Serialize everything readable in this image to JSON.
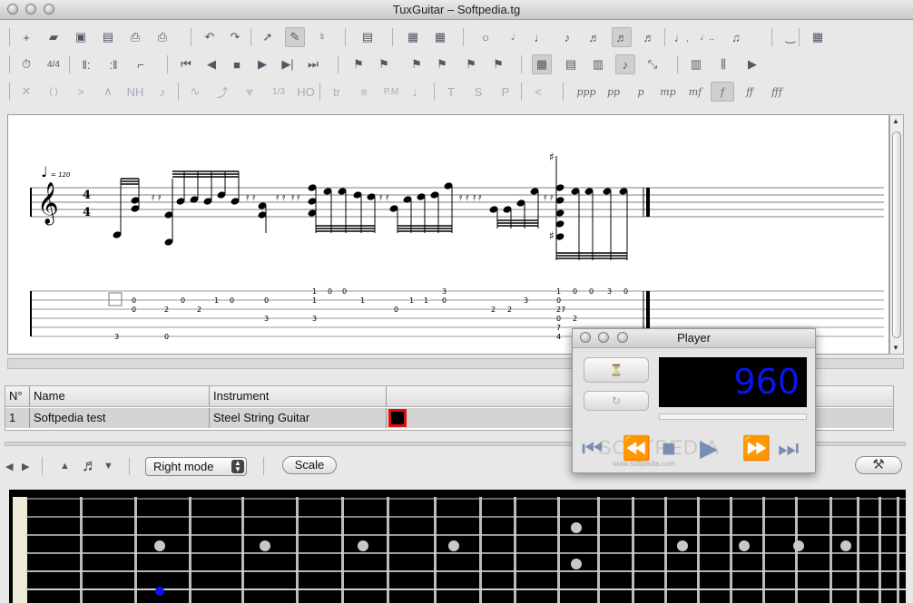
{
  "window": {
    "title": "TuxGuitar – Softpedia.tg"
  },
  "toolbar_row1": [
    {
      "icon": "new-document-icon",
      "glyph": "+"
    },
    {
      "icon": "open-folder-icon",
      "glyph": "▰"
    },
    {
      "icon": "save-icon",
      "glyph": "▣"
    },
    {
      "icon": "save-as-icon",
      "glyph": "▤"
    },
    {
      "icon": "print-icon",
      "glyph": "⎙"
    },
    {
      "icon": "print-preview-icon",
      "glyph": "⎙"
    },
    {
      "icon": "undo-icon",
      "glyph": "↶"
    },
    {
      "icon": "redo-icon",
      "glyph": "↷"
    },
    {
      "icon": "select-mode-icon",
      "glyph": "➚"
    },
    {
      "icon": "edit-mode-icon",
      "glyph": "✎"
    },
    {
      "icon": "natural-key-icon",
      "glyph": "♮"
    },
    {
      "icon": "score-properties-icon",
      "glyph": "▤"
    },
    {
      "icon": "add-measure-icon",
      "glyph": "▦"
    },
    {
      "icon": "remove-measure-icon",
      "glyph": "▦"
    },
    {
      "icon": "whole-note-icon",
      "glyph": "○"
    },
    {
      "icon": "half-note-icon",
      "glyph": "𝅗𝅥"
    },
    {
      "icon": "quarter-note-icon",
      "glyph": "♩"
    },
    {
      "icon": "eighth-note-icon",
      "glyph": "♪"
    },
    {
      "icon": "sixteenth-note-icon",
      "glyph": "♬"
    },
    {
      "icon": "thirty-second-note-icon",
      "glyph": "♬"
    },
    {
      "icon": "sixty-fourth-note-icon",
      "glyph": "♬"
    },
    {
      "icon": "dotted-note-icon",
      "glyph": "♩."
    },
    {
      "icon": "double-dotted-note-icon",
      "glyph": "♩.."
    },
    {
      "icon": "tuplet-icon",
      "glyph": "♫"
    },
    {
      "icon": "tie-icon",
      "glyph": "‿"
    },
    {
      "icon": "layout-menu-icon",
      "glyph": "▦"
    }
  ],
  "toolbar_row2": [
    {
      "icon": "metronome-icon",
      "glyph": "⏱"
    },
    {
      "icon": "time-signature-icon",
      "glyph": "4/4"
    },
    {
      "icon": "repeat-open-icon",
      "glyph": "‖:"
    },
    {
      "icon": "repeat-close-icon",
      "glyph": ":‖"
    },
    {
      "icon": "alternate-ending-icon",
      "glyph": "⌐"
    },
    {
      "icon": "first-measure-icon",
      "glyph": "⏮"
    },
    {
      "icon": "previous-measure-icon",
      "glyph": "◀"
    },
    {
      "icon": "stop-icon",
      "glyph": "■"
    },
    {
      "icon": "play-icon",
      "glyph": "▶"
    },
    {
      "icon": "next-measure-icon",
      "glyph": "▶|"
    },
    {
      "icon": "last-measure-icon",
      "glyph": "⏭"
    },
    {
      "icon": "marker-add-icon",
      "glyph": "⚑"
    },
    {
      "icon": "marker-list-icon",
      "glyph": "⚑"
    },
    {
      "icon": "marker-first-icon",
      "glyph": "⚑"
    },
    {
      "icon": "marker-previous-icon",
      "glyph": "⚑"
    },
    {
      "icon": "marker-next-icon",
      "glyph": "⚑"
    },
    {
      "icon": "marker-last-icon",
      "glyph": "⚑"
    },
    {
      "icon": "view-page-icon",
      "glyph": "▦"
    },
    {
      "icon": "view-linear-icon",
      "glyph": "▤"
    },
    {
      "icon": "view-multitrack-icon",
      "glyph": "▥"
    },
    {
      "icon": "view-score-icon",
      "glyph": "♪"
    },
    {
      "icon": "view-compact-icon",
      "glyph": "⤡"
    },
    {
      "icon": "fretboard-icon",
      "glyph": "▥"
    },
    {
      "icon": "mixer-icon",
      "glyph": "⫼"
    },
    {
      "icon": "transport-icon",
      "glyph": "▶"
    }
  ],
  "toolbar_row3": [
    {
      "icon": "dead-note-icon",
      "glyph": "✕"
    },
    {
      "icon": "ghost-note-icon",
      "glyph": "( )"
    },
    {
      "icon": "accent-icon",
      "glyph": ">"
    },
    {
      "icon": "heavy-accent-icon",
      "glyph": "∧"
    },
    {
      "icon": "harmonic-icon",
      "glyph": "NH"
    },
    {
      "icon": "grace-note-icon",
      "glyph": "♪"
    },
    {
      "icon": "vibrato-icon",
      "glyph": "∿"
    },
    {
      "icon": "bend-icon",
      "glyph": "⤴"
    },
    {
      "icon": "tremolo-bar-icon",
      "glyph": "⩔"
    },
    {
      "icon": "triplet-feel-icon",
      "glyph": "1/3"
    },
    {
      "icon": "hammer-on-icon",
      "glyph": "HO"
    },
    {
      "icon": "trill-icon",
      "glyph": "tr"
    },
    {
      "icon": "tremolo-picking-icon",
      "glyph": "≡"
    },
    {
      "icon": "palm-mute-icon",
      "glyph": "P.M"
    },
    {
      "icon": "staccato-icon",
      "glyph": "♩"
    },
    {
      "icon": "tapping-icon",
      "glyph": "T"
    },
    {
      "icon": "slapping-icon",
      "glyph": "S"
    },
    {
      "icon": "popping-icon",
      "glyph": "P"
    },
    {
      "icon": "fade-in-icon",
      "glyph": "<"
    }
  ],
  "dynamics": [
    "ppp",
    "pp",
    "p",
    "mp",
    "mf",
    "f",
    "ff",
    "fff"
  ],
  "score": {
    "tempo_symbol": "♩",
    "tempo": "= 120",
    "time_sig_top": "4",
    "time_sig_bottom": "4",
    "clef": "𝄞",
    "tab_frets": [
      {
        "s": 1,
        "v": "1"
      },
      {
        "s": 1,
        "v": "0"
      },
      {
        "s": 1,
        "v": "0"
      },
      {
        "s": 1,
        "v": "3"
      },
      {
        "s": 1,
        "v": "1"
      },
      {
        "s": 1,
        "v": "0"
      },
      {
        "s": 1,
        "v": "0"
      },
      {
        "s": 1,
        "v": "3"
      },
      {
        "s": 1,
        "v": "0"
      },
      {
        "s": 2,
        "v": "0"
      },
      {
        "s": 2,
        "v": "0"
      },
      {
        "s": 2,
        "v": "1"
      },
      {
        "s": 2,
        "v": "0"
      },
      {
        "s": 2,
        "v": "0"
      },
      {
        "s": 2,
        "v": "1"
      },
      {
        "s": 2,
        "v": "1"
      },
      {
        "s": 2,
        "v": "1"
      },
      {
        "s": 2,
        "v": "1"
      },
      {
        "s": 2,
        "v": "0"
      },
      {
        "s": 2,
        "v": "3"
      },
      {
        "s": 2,
        "v": "0"
      },
      {
        "s": 3,
        "v": "0"
      },
      {
        "s": 3,
        "v": "2"
      },
      {
        "s": 3,
        "v": "2"
      },
      {
        "s": 3,
        "v": "0"
      },
      {
        "s": 3,
        "v": "2"
      },
      {
        "s": 3,
        "v": "2"
      },
      {
        "s": 3,
        "v": "27"
      },
      {
        "s": 4,
        "v": "3"
      },
      {
        "s": 4,
        "v": "3"
      },
      {
        "s": 4,
        "v": "0"
      },
      {
        "s": 4,
        "v": "2"
      },
      {
        "s": 5,
        "v": "7"
      },
      {
        "s": 6,
        "v": "3"
      },
      {
        "s": 6,
        "v": "0"
      },
      {
        "s": 6,
        "v": "4"
      }
    ]
  },
  "tracks": {
    "headers": [
      "N°",
      "Name",
      "Instrument"
    ],
    "rows": [
      {
        "number": "1",
        "name": "Softpedia test",
        "instrument": "Steel String Guitar"
      }
    ]
  },
  "bottom": {
    "mode_select": "Right mode",
    "scale_button": "Scale",
    "icons": [
      "previous-icon",
      "next-icon",
      "up-icon",
      "note-icon",
      "down-icon"
    ]
  },
  "player": {
    "title": "Player",
    "counter": "960",
    "metronome_icon": "metronome-icon",
    "loop_icon": "loop-icon",
    "controls": [
      "first-icon",
      "previous-icon",
      "stop-icon",
      "play-icon",
      "next-icon",
      "last-icon"
    ],
    "watermark": "SOFTPEDIA",
    "watermark_url": "www.softpedia.com"
  }
}
